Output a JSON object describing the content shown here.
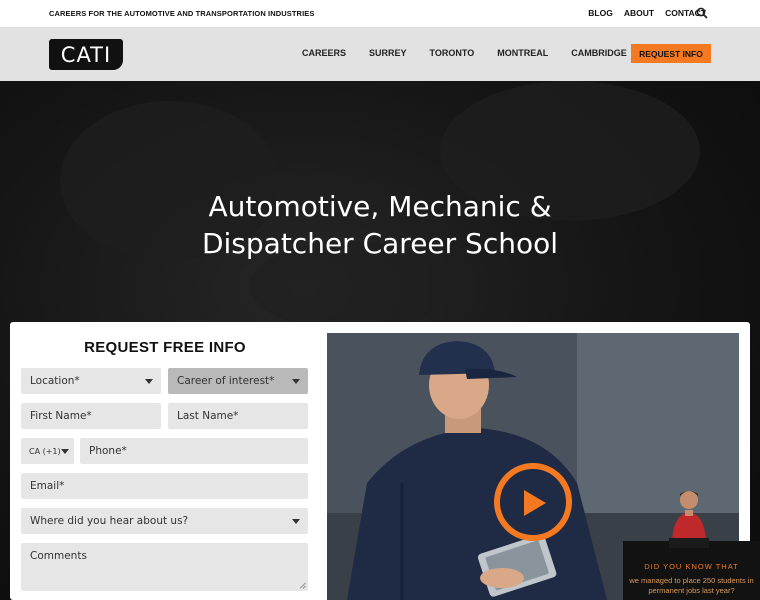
{
  "topbar": {
    "tagline": "CAREERS FOR THE AUTOMOTIVE AND TRANSPORTATION INDUSTRIES",
    "links": [
      "BLOG",
      "ABOUT",
      "CONTACT"
    ]
  },
  "header": {
    "logo": "CATI",
    "nav": [
      "CAREERS",
      "SURREY",
      "TORONTO",
      "MONTREAL",
      "CAMBRIDGE"
    ],
    "request_info": "REQUEST INFO"
  },
  "hero": {
    "title_line1": "Automotive, Mechanic &",
    "title_line2": "Dispatcher Career School"
  },
  "form": {
    "title": "REQUEST FREE INFO",
    "location": "Location*",
    "career": "Career of interest*",
    "first_name": "First Name*",
    "last_name": "Last Name*",
    "country_code": "CA (+1)",
    "phone": "Phone*",
    "email": "Email*",
    "hear_about": "Where did you hear about us?",
    "comments": "Comments"
  },
  "dyk": {
    "title": "DID YOU KNOW THAT",
    "text": "we managed to place 250 students in permanent jobs last year?"
  },
  "colors": {
    "accent": "#f47920",
    "header_bg": "#e2e2e2"
  }
}
